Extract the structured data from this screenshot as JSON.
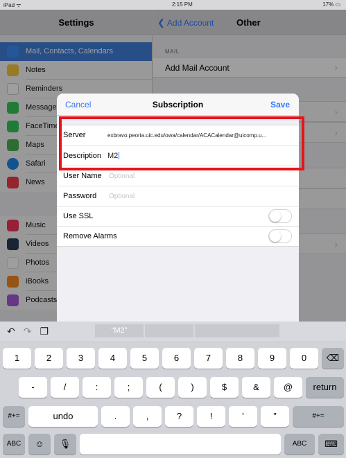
{
  "status_bar": {
    "device": "iPad ᯤ",
    "time": "2:15 PM",
    "battery": "17% ▭"
  },
  "master": {
    "title": "Settings",
    "items": [
      {
        "label": "Mail, Contacts, Calendars",
        "icon": "mail-icon",
        "color": "#3a8df5",
        "selected": true
      },
      {
        "label": "Notes",
        "icon": "notes-icon",
        "color": "#f5c33b"
      },
      {
        "label": "Reminders",
        "icon": "reminders-icon",
        "color": "#ffffff"
      },
      {
        "label": "Messages",
        "icon": "messages-icon",
        "color": "#34c759"
      },
      {
        "label": "FaceTime",
        "icon": "facetime-icon",
        "color": "#34c759"
      },
      {
        "label": "Maps",
        "icon": "maps-icon",
        "color": "#4cae4f"
      },
      {
        "label": "Safari",
        "icon": "safari-icon",
        "color": "#1e88e5"
      },
      {
        "label": "News",
        "icon": "news-icon",
        "color": "#f03b4a"
      },
      {
        "label": "Music",
        "icon": "music-icon",
        "color": "#f2355b"
      },
      {
        "label": "Videos",
        "icon": "videos-icon",
        "color": "#2a3a56"
      },
      {
        "label": "Photos",
        "icon": "photos-icon",
        "color": "#ffffff"
      },
      {
        "label": "iBooks",
        "icon": "ibooks-icon",
        "color": "#f28a1d"
      },
      {
        "label": "Podcasts",
        "icon": "podcasts-icon",
        "color": "#a35ad6"
      }
    ]
  },
  "detail": {
    "back_label": "Add Account",
    "title": "Other",
    "section_header": "MAIL",
    "rows": [
      "Add Mail Account"
    ]
  },
  "modal": {
    "cancel": "Cancel",
    "title": "Subscription",
    "save": "Save",
    "server_label": "Server",
    "server_value": "exbravo.peoria.uic.edu/owa/calendar/ACACalendar@uicomp.u...",
    "description_label": "Description",
    "description_value": "M2",
    "username_label": "User Name",
    "username_placeholder": "Optional",
    "password_label": "Password",
    "password_placeholder": "Optional",
    "ssl_label": "Use SSL",
    "ssl_on": false,
    "alarms_label": "Remove Alarms",
    "alarms_on": false
  },
  "keyboard": {
    "prediction": "“M2”",
    "row1": [
      "1",
      "2",
      "3",
      "4",
      "5",
      "6",
      "7",
      "8",
      "9",
      "0"
    ],
    "row2": [
      "-",
      "/",
      ":",
      ";",
      "(",
      ")",
      "$",
      "&",
      "@"
    ],
    "return": "return",
    "row3_left": "#+=",
    "undo": "undo",
    "row3": [
      ".",
      ",",
      "?",
      "!",
      "’",
      "”"
    ],
    "row3_right": "#+=",
    "abc": "ABC",
    "accent": "#e6141b"
  }
}
